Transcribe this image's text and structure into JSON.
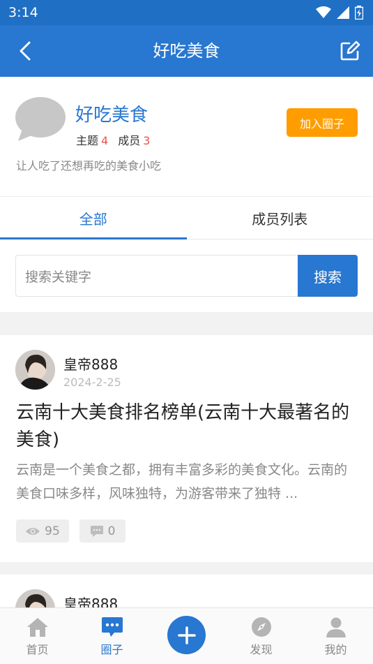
{
  "status_bar": {
    "time": "3:14"
  },
  "header": {
    "title": "好吃美食"
  },
  "circle": {
    "name": "好吃美食",
    "topics_label": "主题",
    "topics_count": "4",
    "members_label": "成员",
    "members_count": "3",
    "join_label": "加入圈子",
    "description": "让人吃了还想再吃的美食小吃"
  },
  "tabs": [
    {
      "label": "全部",
      "active": true
    },
    {
      "label": "成员列表",
      "active": false
    }
  ],
  "search": {
    "placeholder": "搜索关键字",
    "button_label": "搜索"
  },
  "posts": [
    {
      "author": "皇帝888",
      "date": "2024-2-25",
      "title": "云南十大美食排名榜单(云南十大最著名的美食)",
      "excerpt": "云南是一个美食之都，拥有丰富多彩的美食文化。云南的美食口味多样，风味独特，为游客带来了独特 ...",
      "views": "95",
      "comments": "0"
    },
    {
      "author": "皇帝888"
    }
  ],
  "bottom_nav": [
    {
      "label": "首页",
      "icon": "home-icon",
      "active": false
    },
    {
      "label": "圈子",
      "icon": "chat-icon",
      "active": true
    },
    {
      "label": "发现",
      "icon": "compass-icon",
      "active": false
    },
    {
      "label": "我的",
      "icon": "user-icon",
      "active": false
    }
  ],
  "colors": {
    "primary": "#2877d0",
    "accent_orange": "#ff9d00",
    "count_red": "#f05050"
  }
}
